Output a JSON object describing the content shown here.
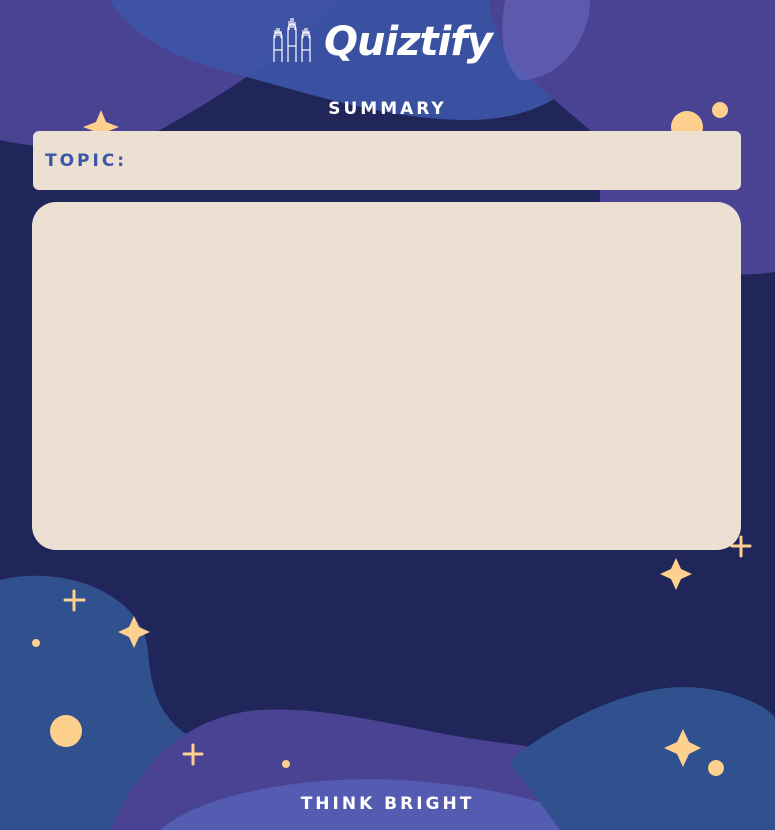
{
  "brand": {
    "name": "Quiztify",
    "logo_icon": "raised-hands-icon"
  },
  "header": {
    "title": "SUMMARY"
  },
  "topic": {
    "label": "TOPIC:",
    "value": ""
  },
  "content": {
    "text": ""
  },
  "footer": {
    "tagline": "THINK BRIGHT"
  },
  "colors": {
    "background": "#20265a",
    "blob_blue": "#3d55a8",
    "blob_purple": "#5a4a9c",
    "card": "#ebe0d2",
    "accent_star": "#fdd08e",
    "topic_label": "#3d55a8"
  }
}
